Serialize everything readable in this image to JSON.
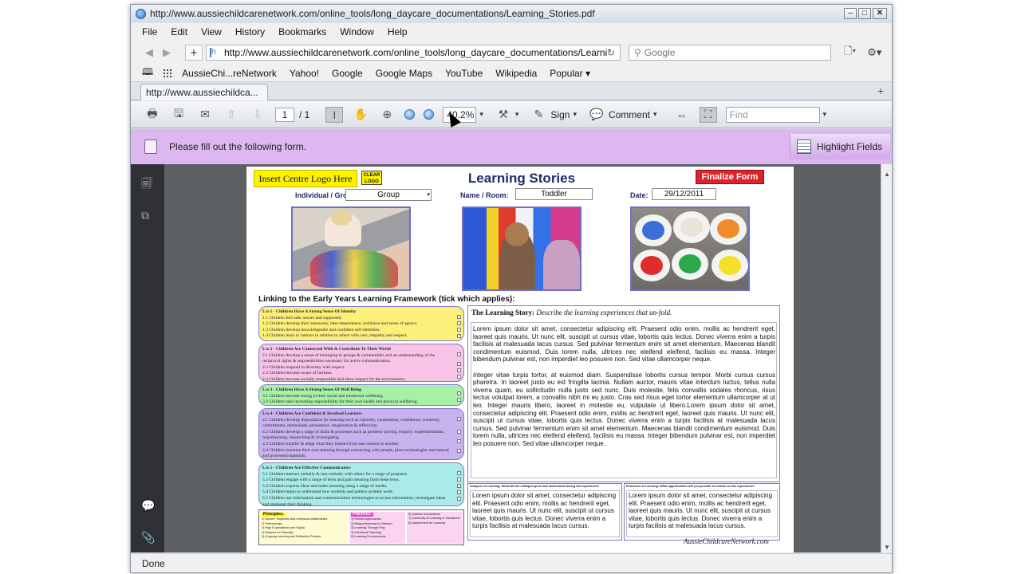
{
  "window": {
    "title": "http://www.aussiechildcarenetwork.com/online_tools/long_daycare_documentations/Learning_Stories.pdf"
  },
  "menu": [
    "File",
    "Edit",
    "View",
    "History",
    "Bookmarks",
    "Window",
    "Help"
  ],
  "nav": {
    "url": "http://www.aussiechildcarenetwork.com/online_tools/long_daycare_documentations/Learning",
    "search_placeholder": "Google"
  },
  "bookmarks": [
    "AussieChi...reNetwork",
    "Yahoo!",
    "Google",
    "Google Maps",
    "YouTube",
    "Wikipedia",
    "Popular"
  ],
  "tab": {
    "label": "http://www.aussiechildca..."
  },
  "pdf_toolbar": {
    "page_current": "1",
    "page_total": "/ 1",
    "zoom": "40.2%",
    "sign_label": "Sign",
    "comment_label": "Comment",
    "find_placeholder": "Find"
  },
  "form_bar": {
    "message": "Please fill out the following form.",
    "highlight_label": "Highlight Fields"
  },
  "status": {
    "text": "Done"
  },
  "form": {
    "logo_label": "Insert Centre Logo Here",
    "clear_logo_label": "CLEAR LOGO",
    "title": "Learning Stories",
    "finalize_label": "Finalize Form",
    "group_label": "Individual / Group:",
    "group_value": "Group",
    "name_label": "Name / Room:",
    "name_value": "Toddler",
    "date_label": "Date:",
    "date_value": "29/12/2011",
    "framework_heading": "Linking to the Early Years Learning Framework (tick which applies):",
    "outcomes": [
      {
        "title": "L/o 1 - Children Have A Strong Sense Of Identity",
        "items": [
          "1.1 Children feel safe, secure and supported.",
          "1.2 Children develop their autonomy, inter-dependence, resilience and sense of agency",
          "1.3 Children develop knowledgeable and confident self-identities.",
          "1.4 Children learn to interact in relation to others with care, empathy and respect."
        ]
      },
      {
        "title": "L/o 2 - Children Are Connected With & Contribute To Their World",
        "items": [
          "2.1 Children develop a sense of belonging to groups & communities and an understanding of the reciprocal rights & responsibilities necessary for active communication.",
          "2.2 Children respond to diversity with respect.",
          "2.3 Children become aware of fairness.",
          "2.4 Children become socially responsible and show respect for the environment."
        ]
      },
      {
        "title": "L/o 3 - Children Have A Strong Sense Of Well Being",
        "items": [
          "3.1 Children become strong in their social and emotional wellbeing.",
          "3.2 Children take increasing responsibility for their own health and physical wellbeing."
        ]
      },
      {
        "title": "L/o 4 - Children Are Confident & Involved Learners",
        "items": [
          "4.1 Children develop dispositions for learning such as curiosity, cooperation, confidence, creativity, commitment, enthusiasm, persistence, imagination & reflexivity.",
          "4.2 Children develop a range of skills & processes such as problem solving, enquiry, experimentation, hypothesising, researching & investigating.",
          "4.3 Children transfer & adapt what they learned from one context to another.",
          "4.4 Children resource their own learning through connecting with people, place technologies and natural and processed materials."
        ]
      },
      {
        "title": "L/o 5 - Children Are Effective Communicators",
        "items": [
          "5.1 Children interact verbally & non-verbally with others for a range of purposes.",
          "5.2 Children engage with a range of texts and gain meaning from these texts.",
          "5.3 Children express ideas and make meaning using a range of media.",
          "5.4 Children begin to understand how symbols and pattern systems work.",
          "5.5 Children use information and communication technologies to access information, investigate ideas and represent their thinking."
        ]
      }
    ],
    "principles": {
      "title": "Principles:",
      "items": [
        "1) Secure, respectful and reciprocal relationships",
        "2) Partnerships",
        "3) High Expectations and Equity",
        "4) Respect for Diversity",
        "5) Ongoing Learning and Reflective Practice"
      ]
    },
    "practices": {
      "title": "Practices:",
      "items": [
        "1) Holistic Approaches",
        "2) Responsiveness to Children",
        "3) Learning Through Play",
        "4) Intentional Teaching",
        "5) Learning Environments"
      ]
    },
    "practices2": {
      "items": [
        "6) Cultural Competence",
        "7) Continuity of Learning & Transitions",
        "8) Assessment for Learning"
      ]
    },
    "story_heading": "The Learning Story:",
    "story_subheading": "Describe the learning experiences that un-fold.",
    "story_text": "Lorem ipsum dolor sit amet, consectetur adipiscing elit. Praesent odio enim, mollis ac hendrerit eget, laoreet quis mauris. Ut nunc elit, suscipit ut cursus vitae, lobortis quis lectus. Donec viverra enim a turpis facilisis at malesuada lacus cursus. Sed pulvinar fermentum enim sit amet elementum. Maecenas blandit condimentum euismod. Duis lorem nulla, ultrices nec eleifend eleifend, facilisis eu massa. Integer bibendum pulvinar est, non imperdiet leo posuere non. Sed vitae ullamcorper neque.\n\nInteger vitae turpis tortor, at euismod diam. Suspendisse lobortis cursus tempor. Morbi cursus cursus pharetra. In laoreet justo eu est fringilla lacinia. Nullam auctor, mauris vitae interdum luctus, tellus nulla viverra quam, eu sollicitudin nulla justo sed nunc. Duis molestie, felis convallis sodales rhoncus, risus lectus volutpat lorem, a convallis nibh mi eu justo. Cras sed risus eget tortor elementum ullamcorper at ut leo. Integer mauris libero, laoreet in molestie eu, vulputate ut libero.Lorem ipsum dolor sit amet, consectetur adipiscing elit. Praesent odio enim, mollis ac hendrerit eget, laoreet quis mauris. Ut nunc elit, suscipit ut cursus vitae, lobortis quis lectus. Donec viverra enim a turpis facilisis at malesuada lacus cursus. Sed pulvinar fermentum enim sit amet elementum. Maecenas blandit condimentum euismod. Duis lorem nulla, ultrices nec eleifend eleifend, facilisis eu massa. Integer bibendum pulvinar est, non imperdiet leo posuere non. Sed vitae ullamcorper neque.",
    "analysis_heading": "Analysis of Learning: What did the child/group do and understand during the experience?",
    "analysis_text": "Lorem ipsum dolor sit amet, consectetur adipiscing elit. Praesent odio enim, mollis ac hendrerit eget, laoreet quis mauris. Ut nunc elit, suscipit ut cursus vitae, lobortis quis lectus. Donec viverra enim a turpis facilisis at malesuada lacus cursus.",
    "extension_heading": "Extension of Learning: What opportunities will you provide to extend on this experience?",
    "extension_text": "Lorem ipsum dolor sit amet, consectetur adipiscing elit. Praesent odio enim, mollis ac hendrerit eget, laoreet quis mauris. Ut nunc elit, suscipit ut cursus vitae, lobortis quis lectus. Donec viverra enim a turpis facilisis at malesuada lacus cursus.",
    "brand": "AussieChildcareNetwork.com"
  },
  "colors": {
    "form_bar": "#ddb8f0",
    "finalize": "#e0232a",
    "title": "#1f2a6e",
    "logo_bg": "#fff200"
  }
}
